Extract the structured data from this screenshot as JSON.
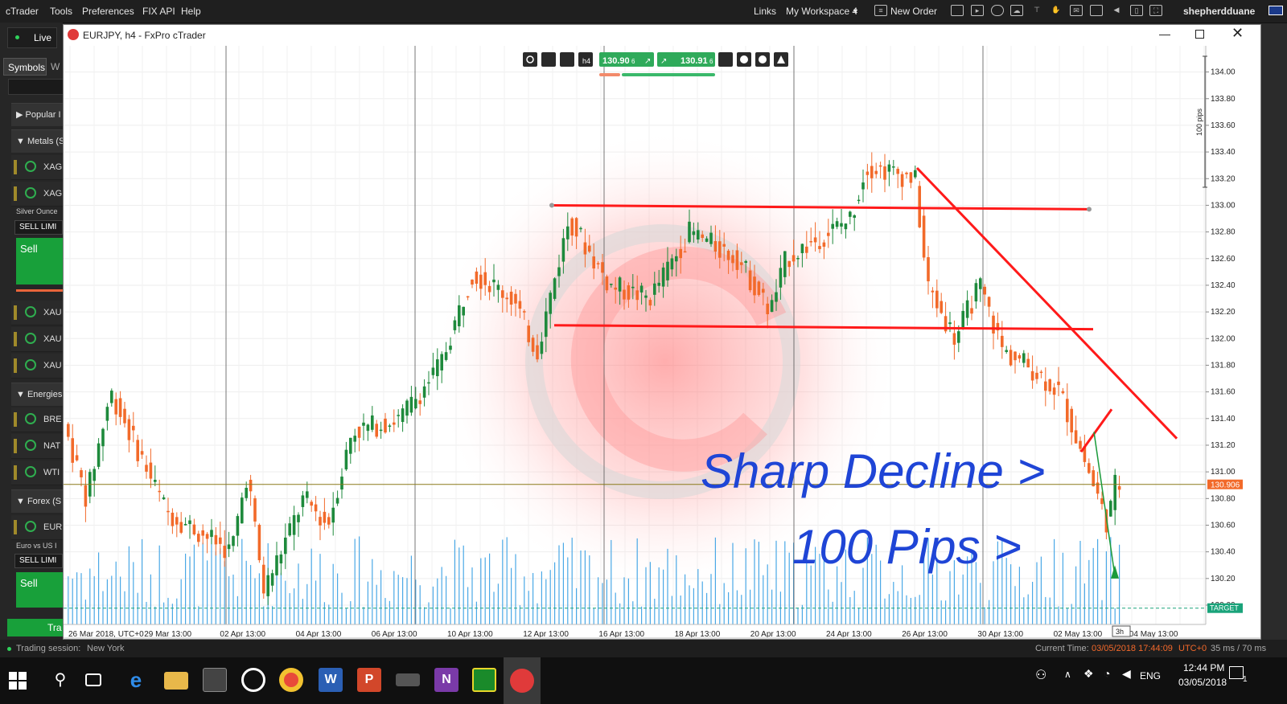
{
  "menubar": {
    "items": [
      "cTrader",
      "Tools",
      "Preferences",
      "FIX API",
      "Help"
    ],
    "links_label": "Links",
    "workspace_label": "My Workspace 4",
    "new_order_label": "New Order",
    "username": "shepherdduane"
  },
  "left_panel": {
    "live_label": "Live",
    "tab_symbols": "Symbols",
    "tab_w": "W",
    "groups": [
      {
        "label": "Popular I",
        "expanded": false
      },
      {
        "label": "Metals (S",
        "expanded": true
      },
      {
        "label": "Energies",
        "expanded": true
      },
      {
        "label": "Forex (S",
        "expanded": true
      }
    ],
    "rows": [
      "XAG",
      "XAG",
      "XAU",
      "XAU",
      "XAU",
      "BRE",
      "NAT",
      "WTI",
      "EUR"
    ],
    "silver_caption": "Silver Ounce",
    "euro_caption": "Euro vs US I",
    "sell_limit_label": "SELL LIMI",
    "sell_label": "Sell",
    "trade_label": "Tra"
  },
  "window": {
    "title": "EURJPY, h4 - FxPro cTrader",
    "minimize_icon": "minimize-icon",
    "maximize_icon": "maximize-icon",
    "close_icon": "close-icon"
  },
  "chart_toolbar": {
    "period": "h4",
    "sell_price": "130.90",
    "sell_price_suffix": "6",
    "buy_price": "130.91",
    "buy_price_suffix": "6"
  },
  "chart_data": {
    "type": "candlestick",
    "symbol": "EURJPY",
    "timeframe": "h4",
    "y_ticks": [
      "134.00",
      "133.80",
      "133.60",
      "133.40",
      "133.20",
      "133.00",
      "132.80",
      "132.60",
      "132.40",
      "132.20",
      "132.00",
      "131.80",
      "131.60",
      "131.40",
      "131.20",
      "131.00",
      "130.80",
      "130.60",
      "130.40",
      "130.20",
      "130.00"
    ],
    "ylim": [
      130.0,
      134.1
    ],
    "current_price_label": "130.906",
    "current_price": 130.906,
    "target_label": "TARGET",
    "target_price": 130.05,
    "pips_scale_label": "100 pips",
    "x_ticks": [
      "26 Mar 2018, UTC+0",
      "29 Mar 13:00",
      "02 Apr 13:00",
      "04 Apr 13:00",
      "06 Apr 13:00",
      "10 Apr 13:00",
      "12 Apr 13:00",
      "16 Apr 13:00",
      "18 Apr 13:00",
      "20 Apr 13:00",
      "24 Apr 13:00",
      "26 Apr 13:00",
      "30 Apr 13:00",
      "02 May 13:00",
      "04 May 13:00"
    ],
    "countdown_label": "3h",
    "annotations": [
      "Sharp Decline >",
      "100 Pips >"
    ],
    "trendlines": [
      {
        "from": [
          0,
          133.0
        ],
        "to": [
          1,
          132.97
        ],
        "kind": "resistance"
      },
      {
        "from": [
          0,
          132.1
        ],
        "to": [
          1,
          132.07
        ],
        "kind": "support"
      },
      {
        "from": [
          0,
          133.28
        ],
        "to": [
          1,
          131.25
        ],
        "kind": "descending"
      }
    ],
    "colors": {
      "bull": "#1e8a3c",
      "bear": "#f26a2a",
      "volume": "#4aa8e6",
      "trendline": "#ff1a1a",
      "price_line": "#8a7a1a",
      "annotation": "#1f45d6"
    }
  },
  "status": {
    "trading_session_label": "Trading session:",
    "trading_session_value": "New York",
    "current_time_label": "Current Time:",
    "current_time_value": "03/05/2018 17:44:09",
    "timezone": "UTC+0",
    "latency": "35 ms / 70 ms"
  },
  "taskbar": {
    "language": "ENG",
    "time": "12:44 PM",
    "date": "03/05/2018",
    "notification_count": "1"
  }
}
